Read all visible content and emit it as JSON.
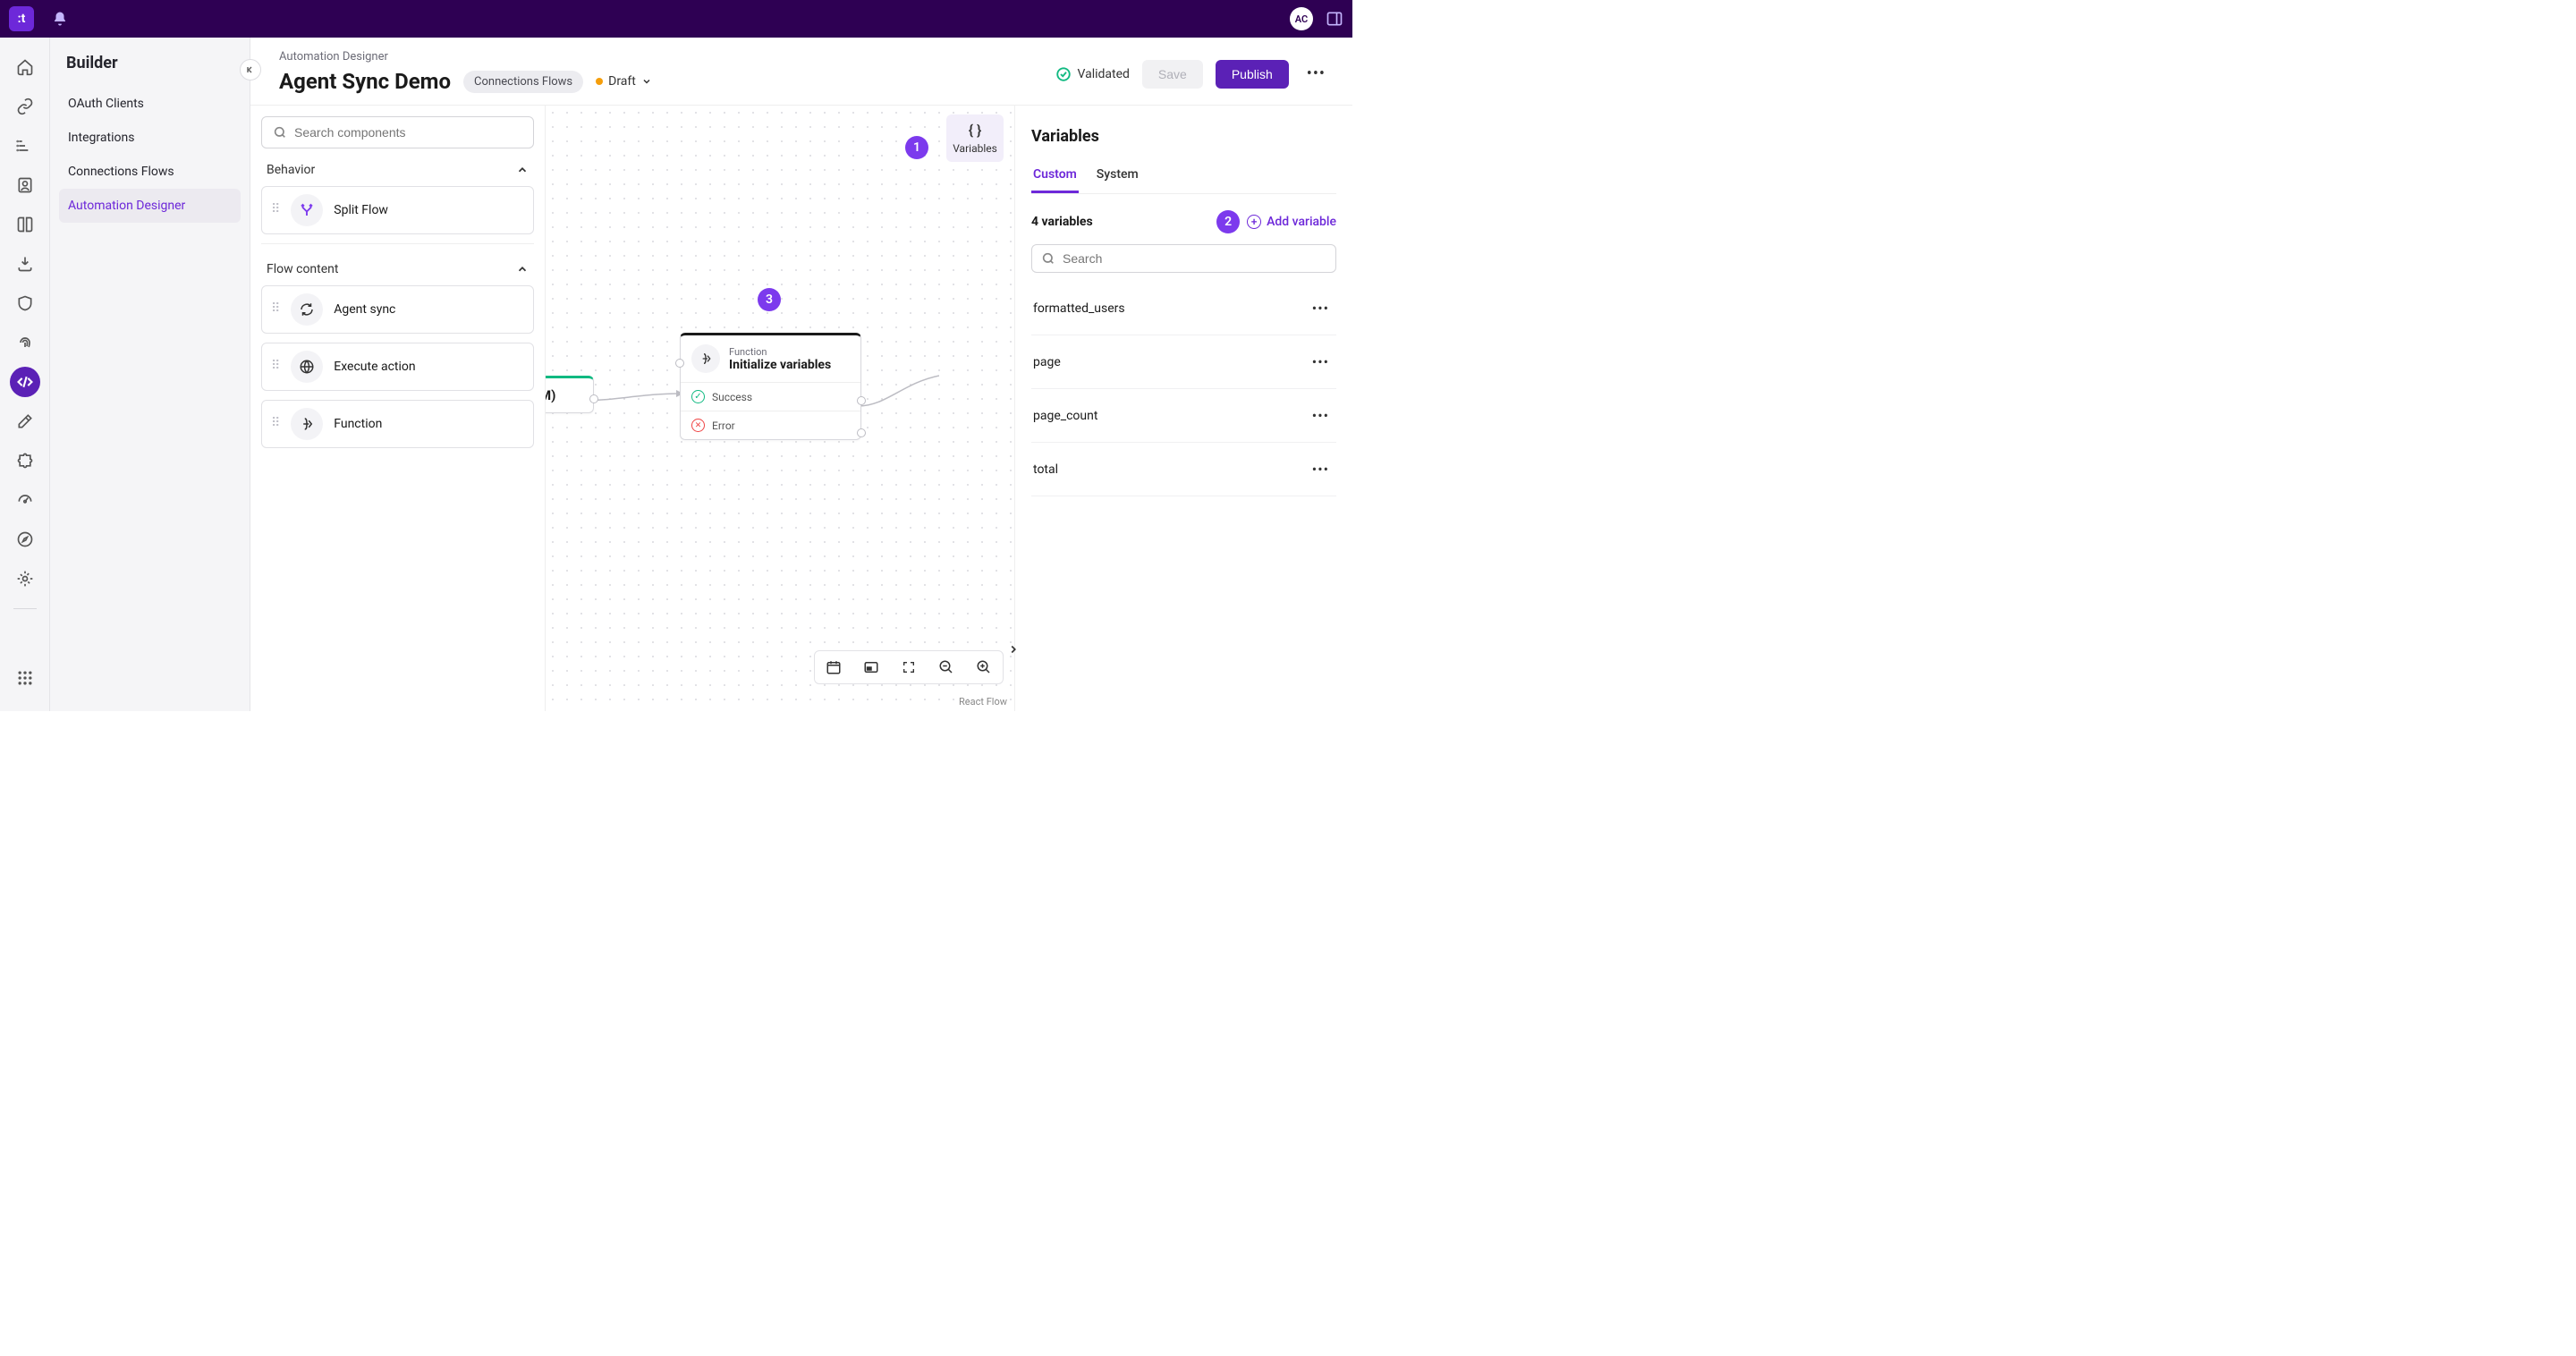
{
  "topbar": {
    "logo_text": ":t",
    "avatar_initials": "AC"
  },
  "sidebar": {
    "title": "Builder",
    "items": [
      {
        "label": "OAuth Clients"
      },
      {
        "label": "Integrations"
      },
      {
        "label": "Connections Flows"
      },
      {
        "label": "Automation Designer"
      }
    ]
  },
  "header": {
    "breadcrumb": "Automation Designer",
    "title": "Agent Sync Demo",
    "badge": "Connections Flows",
    "status_label": "Draft",
    "validated_label": "Validated",
    "save_label": "Save",
    "publish_label": "Publish"
  },
  "components": {
    "search_placeholder": "Search components",
    "section_behavior": "Behavior",
    "section_flow_content": "Flow content",
    "behavior_items": [
      {
        "label": "Split Flow"
      }
    ],
    "flow_items": [
      {
        "label": "Agent sync"
      },
      {
        "label": "Execute action"
      },
      {
        "label": "Function"
      }
    ]
  },
  "canvas": {
    "start_node_label": "M)",
    "node_type": "Function",
    "node_name": "Initialize variables",
    "row_success": "Success",
    "row_error": "Error",
    "variables_btn": "Variables",
    "attribution": "React Flow"
  },
  "annotations": {
    "a1": "1",
    "a2": "2",
    "a3": "3"
  },
  "vars_panel": {
    "title": "Variables",
    "tab_custom": "Custom",
    "tab_system": "System",
    "count_label": "4 variables",
    "add_label": "Add variable",
    "search_placeholder": "Search",
    "variables": [
      {
        "name": "formatted_users"
      },
      {
        "name": "page"
      },
      {
        "name": "page_count"
      },
      {
        "name": "total"
      }
    ]
  }
}
